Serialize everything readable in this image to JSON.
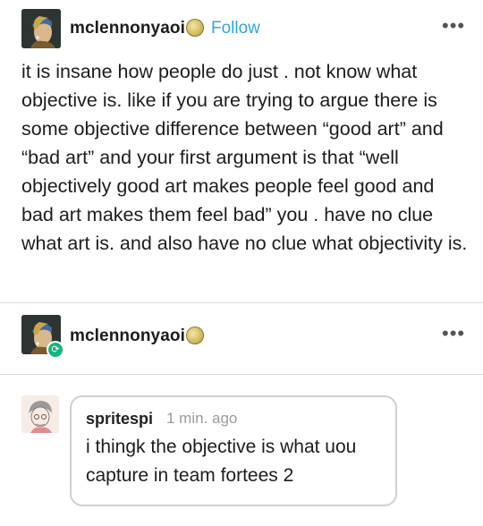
{
  "post": {
    "username": "mclennonyaoi",
    "follow_label": "Follow",
    "more_label": "•••",
    "avatar_icon": "pearl-earring-portrait-avatar",
    "badge_icon": "gold-moon-badge-icon",
    "body": "it is insane how people do just . not know what objective is. like if you are trying to argue there is some objective difference between “good art” and “bad art” and your first argument is that “well objectively good art makes people feel good and bad art makes them feel bad” you . have no clue what art is. and also have no clue what objectivity is."
  },
  "reblog": {
    "username": "mclennonyaoi",
    "more_label": "•••",
    "reblog_icon": "reblog-icon",
    "badge_icon": "gold-moon-badge-icon"
  },
  "chat": {
    "name": "spritespi",
    "time": "1 min. ago",
    "text": "i thingk the objective is what uou capture in team fortees 2",
    "avatar_icon": "sketch-character-avatar"
  },
  "colors": {
    "follow": "#2fa6e0",
    "reblog_green": "#13b57a",
    "divider": "#d8d8d8",
    "bubble_border": "#cfcfcf"
  }
}
